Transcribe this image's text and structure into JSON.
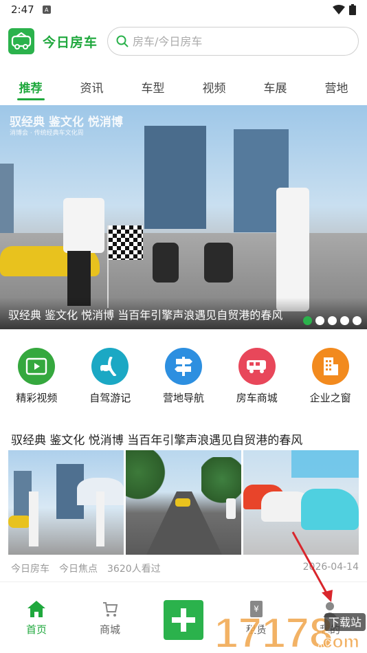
{
  "status_bar": {
    "time": "2:47"
  },
  "header": {
    "brand": "今日房车",
    "search_placeholder": "房车/今日房车"
  },
  "tabs": [
    {
      "label": "推荐",
      "active": true
    },
    {
      "label": "资讯"
    },
    {
      "label": "车型"
    },
    {
      "label": "视频"
    },
    {
      "label": "车展"
    },
    {
      "label": "营地"
    }
  ],
  "banner": {
    "overlay_title": "驭经典 鉴文化 悦消博",
    "overlay_sub": "消博会 · 传统经典车文化周",
    "caption": "驭经典 鉴文化 悦消博 当百年引擎声浪遇见自贸港的春风",
    "slide_count": 5,
    "active_slide": 1
  },
  "quick_links": [
    {
      "label": "精彩视频",
      "icon": "video-icon",
      "color": "#35a83e"
    },
    {
      "label": "自驾游记",
      "icon": "road-trip-icon",
      "color": "#1ba8c4"
    },
    {
      "label": "营地导航",
      "icon": "signpost-icon",
      "color": "#2d8fe0"
    },
    {
      "label": "房车商城",
      "icon": "rv-icon",
      "color": "#e8475a"
    },
    {
      "label": "企业之窗",
      "icon": "building-icon",
      "color": "#f28a1e"
    }
  ],
  "article": {
    "title": "驭经典 鉴文化 悦消博 当百年引擎声浪遇见自贸港的春风",
    "source": "今日房车",
    "column": "今日焦点",
    "views": "3620人看过",
    "date": "2026-04-14"
  },
  "bottom_nav": [
    {
      "label": "首页",
      "icon": "home-icon",
      "active": true
    },
    {
      "label": "商城",
      "icon": "cart-icon"
    },
    {
      "label": "",
      "icon": "plus-icon"
    },
    {
      "label": "租赁",
      "icon": "rent-icon"
    },
    {
      "label": "我的",
      "icon": "user-icon"
    }
  ],
  "watermark": {
    "brand": "17178",
    "suffix": ".com",
    "tag": "下载站"
  },
  "colors": {
    "accent": "#1fa83d",
    "accent_bg": "#2bb24c"
  }
}
